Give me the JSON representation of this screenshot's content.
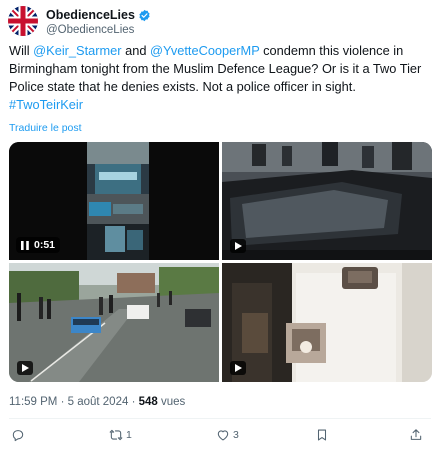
{
  "author": {
    "display_name": "ObedienceLies",
    "handle": "@ObedienceLies",
    "avatar_icon": "union-jack-flag-icon",
    "verified_icon": "verified-badge-icon",
    "verified_color": "#1d9bf0"
  },
  "tweet": {
    "part1": "Will ",
    "mention1": "@Keir_Starmer",
    "part2": " and ",
    "mention2": "@YvetteCooperMP",
    "part3": " condemn this violence in Birmingham tonight from the Muslim Defence League? Or is it a Two Tier Police state that he denies exists. Not a police officer in sight.",
    "hashtag": "#TwoTeirKeir",
    "translate_label": "Traduire le post"
  },
  "media": [
    {
      "kind": "video",
      "duration": "0:51"
    },
    {
      "kind": "video"
    },
    {
      "kind": "video"
    },
    {
      "kind": "video"
    }
  ],
  "meta": {
    "time": "11:59 PM",
    "separator1": " · ",
    "date": "5 août 2024",
    "separator2": " · ",
    "views_count": "548",
    "views_label": " vues"
  },
  "actions": {
    "reply_count": "",
    "repost_count": "1",
    "like_count": "3",
    "icons": [
      "reply-icon",
      "repost-icon",
      "like-icon",
      "bookmark-icon",
      "share-icon"
    ]
  },
  "colors": {
    "accent": "#1d9bf0",
    "text": "#0f1419",
    "secondary": "#536471"
  }
}
